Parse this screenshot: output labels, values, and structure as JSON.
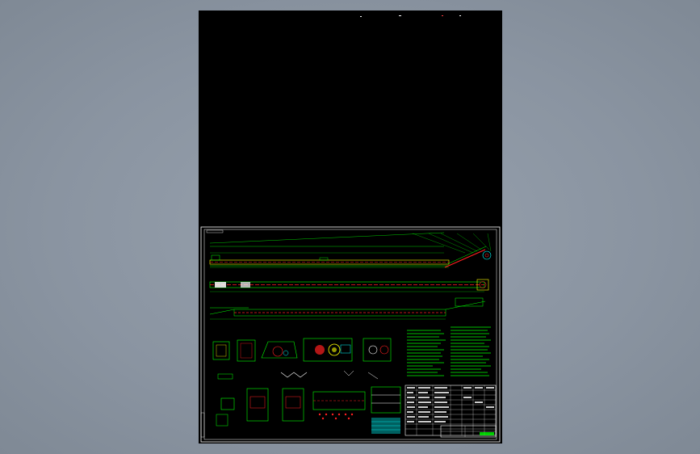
{
  "viewer": {
    "background": "#8a94a1",
    "sheet_color": "#000000"
  },
  "drawing": {
    "frame_color": "#ffffff",
    "colors": {
      "green": "#00ff00",
      "red": "#ff2020",
      "yellow": "#ffff00",
      "cyan": "#00ffff",
      "white": "#ffffff",
      "magenta": "#ff00ff"
    },
    "title_block_label": "",
    "views": [
      "conveyor-elevation",
      "conveyor-plan",
      "conveyor-support-view",
      "section-details",
      "technical-notes",
      "bill-of-materials",
      "title-block"
    ]
  }
}
